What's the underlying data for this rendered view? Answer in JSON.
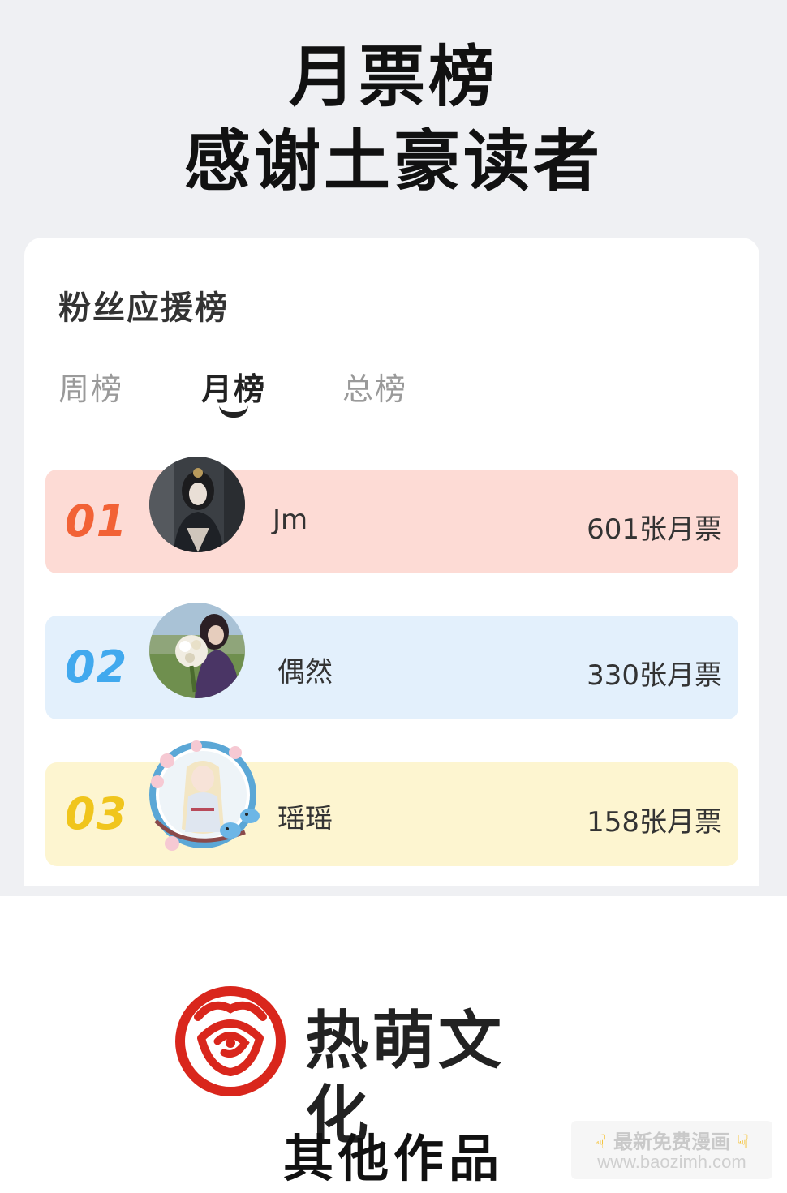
{
  "header": {
    "line1": "月票榜",
    "line2": "感谢土豪读者"
  },
  "card": {
    "title": "粉丝应援榜",
    "tabs": [
      {
        "label": "周榜",
        "active": false
      },
      {
        "label": "月榜",
        "active": true
      },
      {
        "label": "总榜",
        "active": false
      }
    ]
  },
  "ranking": [
    {
      "rank": "01",
      "name": "Jm",
      "votes": "601张月票",
      "color": "#f26236",
      "bg": "#fddbd5"
    },
    {
      "rank": "02",
      "name": "偶然",
      "votes": "330张月票",
      "color": "#41a9ee",
      "bg": "#e3f0fc"
    },
    {
      "rank": "03",
      "name": "瑶瑶",
      "votes": "158张月票",
      "color": "#f0c51c",
      "bg": "#fdf5d0"
    }
  ],
  "brand": {
    "name": "热萌文化",
    "logo_icon": "rose-logo-icon",
    "logo_color": "#d9261c"
  },
  "footer": {
    "other_works": "其他作品"
  },
  "watermark": {
    "line1": "最新免费漫画",
    "line2": "www.baozimh.com"
  }
}
